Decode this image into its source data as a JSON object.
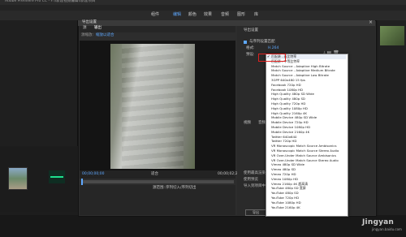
{
  "app": {
    "title": "Adobe Premiere Pro CC - F:\\\\新建视频编辑\\\\新建项目",
    "workspace_tabs": [
      "组件",
      "编辑",
      "颜色",
      "效果",
      "音频",
      "图形",
      "库"
    ],
    "active_workspace": "编辑"
  },
  "dialog": {
    "title": "导出设置",
    "close": "×",
    "preview_tabs": [
      "源",
      "输出"
    ],
    "active_preview_tab": "输出",
    "source_scale_label": "源缩放:",
    "source_scale_value": "缩放以适合",
    "timecode_start": "00;00;00;00",
    "timecode_end": "00;00;02;24",
    "fit_label": "适合",
    "source_range_label": "源范围:",
    "source_range_value": "序列切入/序列切出",
    "export_button": "导出"
  },
  "settings": {
    "section_title": "导出设置",
    "match_sequence": "与序列设置匹配",
    "format_label": "格式:",
    "format_value": "H.264",
    "preset_label": "预设:",
    "preset_value": "匹配源 - 高比特率",
    "video_tab": "视频",
    "audio_tab": "音频",
    "lower_options": [
      "使用最高渲染质量",
      "使用预览",
      "导入到项目中"
    ]
  },
  "preset_list": {
    "selected": "匹配源 - 高比特率",
    "items": [
      "匹配源 - 高比特率",
      "匹配源 - 中等比特率",
      "Match Source - Adaptive High Bitrate",
      "Match Source - Adaptive Medium Bitrate",
      "Match Source - Adaptive Low Bitrate",
      "3GPP 640x480 15 fps",
      "Facebook 720p HD",
      "Facebook 1080p HD",
      "High Quality 480p SD Wide",
      "High Quality 480p SD",
      "High Quality 720p HD",
      "High Quality 1080p HD",
      "High Quality 2160p 4K",
      "Mobile Device 480p SD Wide",
      "Mobile Device 720p HD",
      "Mobile Device 1080p HD",
      "Mobile Device 2160p 4K",
      "Twitter 640x640",
      "Twitter 720p HD",
      "VR Monoscopic Match Source Ambisonics",
      "VR Monoscopic Match Source Stereo Audio",
      "VR Over-Under Match Source Ambisonics",
      "VR Over-Under Match Source Stereo Audio",
      "Vimeo 480p SD Wide",
      "Vimeo 480p SD",
      "Vimeo 720p HD",
      "Vimeo 1080p HD",
      "Vimeo 2160p 4K 超高清",
      "YouTube 480p SD 宽屏",
      "YouTube 480p SD",
      "YouTube 720p HD",
      "YouTube 1080p HD",
      "YouTube 2160p 4K"
    ]
  },
  "watermark": {
    "text": "Jingyan",
    "sub": "jingyan.baidu.com"
  }
}
